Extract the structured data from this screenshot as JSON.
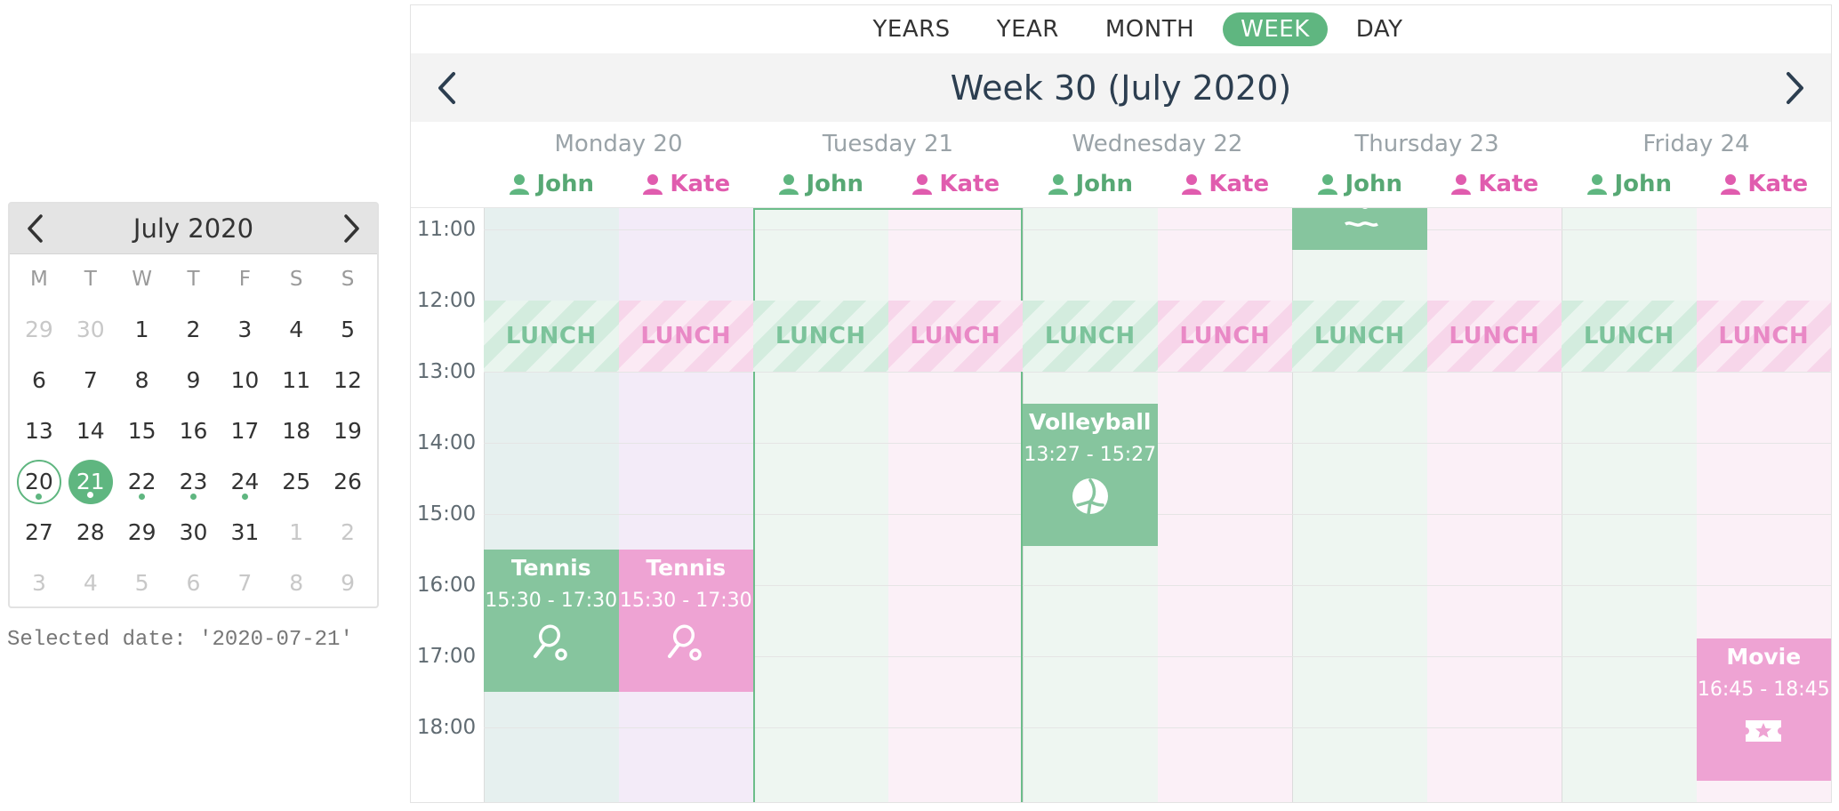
{
  "mini_calendar": {
    "title": "July 2020",
    "weekdays": [
      "M",
      "T",
      "W",
      "T",
      "F",
      "S",
      "S"
    ],
    "days": [
      {
        "label": "29",
        "state": "out"
      },
      {
        "label": "30",
        "state": "out"
      },
      {
        "label": "1"
      },
      {
        "label": "2"
      },
      {
        "label": "3"
      },
      {
        "label": "4"
      },
      {
        "label": "5"
      },
      {
        "label": "6"
      },
      {
        "label": "7"
      },
      {
        "label": "8"
      },
      {
        "label": "9"
      },
      {
        "label": "10"
      },
      {
        "label": "11"
      },
      {
        "label": "12"
      },
      {
        "label": "13"
      },
      {
        "label": "14"
      },
      {
        "label": "15"
      },
      {
        "label": "16"
      },
      {
        "label": "17"
      },
      {
        "label": "18"
      },
      {
        "label": "19"
      },
      {
        "label": "20",
        "state": "today",
        "dot": true
      },
      {
        "label": "21",
        "state": "selected",
        "dot": true
      },
      {
        "label": "22",
        "dot": true
      },
      {
        "label": "23",
        "dot": true
      },
      {
        "label": "24",
        "dot": true
      },
      {
        "label": "25"
      },
      {
        "label": "26"
      },
      {
        "label": "27"
      },
      {
        "label": "28"
      },
      {
        "label": "29"
      },
      {
        "label": "30"
      },
      {
        "label": "31"
      },
      {
        "label": "1",
        "state": "out"
      },
      {
        "label": "2",
        "state": "out"
      },
      {
        "label": "3",
        "state": "out"
      },
      {
        "label": "4",
        "state": "out"
      },
      {
        "label": "5",
        "state": "out"
      },
      {
        "label": "6",
        "state": "out"
      },
      {
        "label": "7",
        "state": "out"
      },
      {
        "label": "8",
        "state": "out"
      },
      {
        "label": "9",
        "state": "out"
      }
    ]
  },
  "selected_date_text": "Selected date: '2020-07-21'",
  "views": [
    {
      "label": "YEARS",
      "active": false
    },
    {
      "label": "YEAR",
      "active": false
    },
    {
      "label": "MONTH",
      "active": false
    },
    {
      "label": "WEEK",
      "active": true
    },
    {
      "label": "DAY",
      "active": false
    }
  ],
  "week_title": "Week 30 (July 2020)",
  "people": [
    {
      "name": "John",
      "key": "john"
    },
    {
      "name": "Kate",
      "key": "kate"
    }
  ],
  "days": [
    {
      "name": "Monday 20"
    },
    {
      "name": "Tuesday 21",
      "selected": true
    },
    {
      "name": "Wednesday 22"
    },
    {
      "name": "Thursday 23"
    },
    {
      "name": "Friday 24"
    }
  ],
  "time_labels": [
    "11:00",
    "12:00",
    "13:00",
    "14:00",
    "15:00",
    "16:00",
    "17:00",
    "18:00"
  ],
  "lunch_label": "LUNCH",
  "events": [
    {
      "day": 0,
      "person": "john",
      "title": "Tennis",
      "time": "15:30 - 17:30",
      "icon": "tennis-racket-icon"
    },
    {
      "day": 0,
      "person": "kate",
      "title": "Tennis",
      "time": "15:30 - 17:30",
      "icon": "tennis-racket-icon"
    },
    {
      "day": 2,
      "person": "john",
      "title": "Volleyball",
      "time": "13:27 - 15:27",
      "icon": "volleyball-icon"
    },
    {
      "day": 3,
      "person": "john",
      "title": "",
      "time": "",
      "icon": "swimming-icon"
    },
    {
      "day": 4,
      "person": "kate",
      "title": "Movie",
      "time": "16:45 - 18:45",
      "icon": "ticket-icon"
    }
  ],
  "colors": {
    "john": "#5fb680",
    "kate": "#e05cae"
  }
}
